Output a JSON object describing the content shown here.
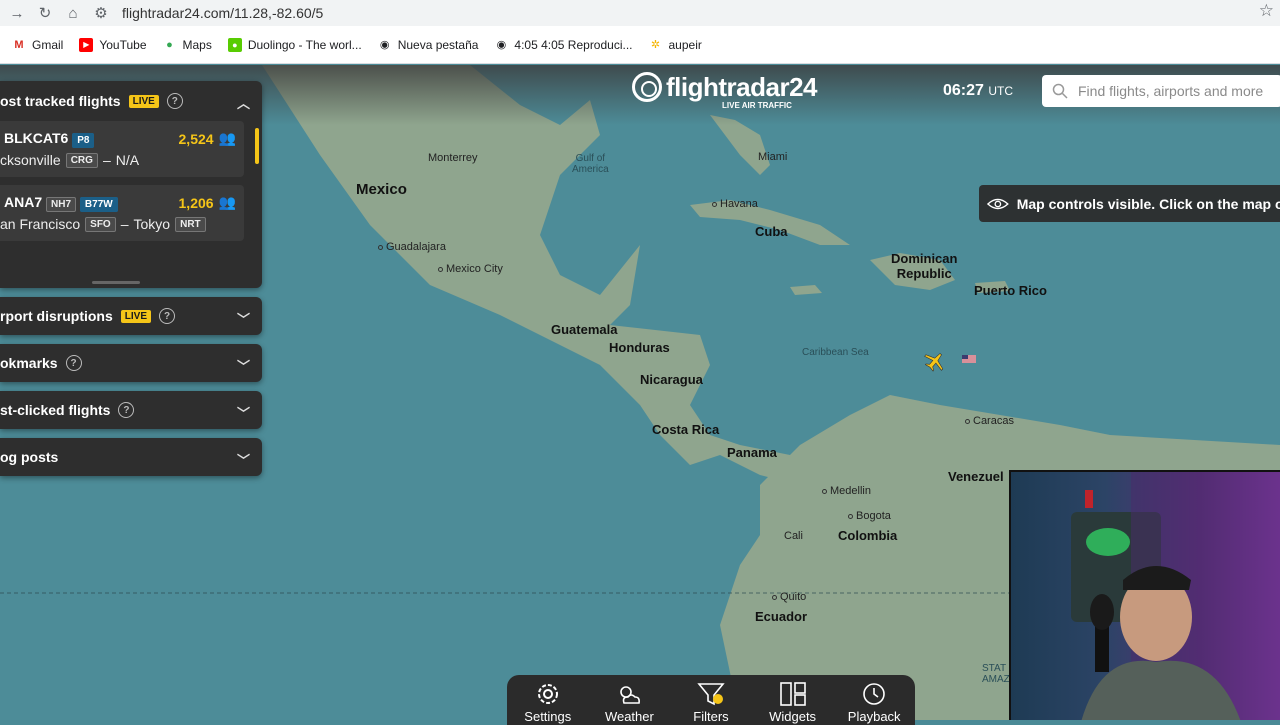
{
  "browser": {
    "url": "flightradar24.com/11.28,-82.60/5",
    "bookmarks": [
      {
        "label": "Gmail",
        "icon": "gmail-icon"
      },
      {
        "label": "YouTube",
        "icon": "youtube-icon"
      },
      {
        "label": "Maps",
        "icon": "maps-icon"
      },
      {
        "label": "Duolingo - The worl...",
        "icon": "duolingo-icon"
      },
      {
        "label": "Nueva pestaña",
        "icon": "globe-icon"
      },
      {
        "label": "4:05 4:05 Reproduci...",
        "icon": "globe-icon"
      },
      {
        "label": "aupeir",
        "icon": "app-icon"
      }
    ]
  },
  "header": {
    "logo": "flightradar24",
    "logo_sub": "LIVE AIR TRAFFIC",
    "time": "06:27",
    "time_zone": "UTC",
    "search_placeholder": "Find flights, airports and more"
  },
  "panel": {
    "most_tracked": {
      "title": "ost tracked flights",
      "live": "LIVE",
      "flights": [
        {
          "callsign": "BLKCAT6",
          "type": "P8",
          "count": "2,524",
          "route_from": "cksonville",
          "from_code": "CRG",
          "route_to": "N/A",
          "to_code": ""
        },
        {
          "callsign": "ANA7",
          "airline": "NH7",
          "type": "B77W",
          "count": "1,206",
          "route_from": "an Francisco",
          "from_code": "SFO",
          "route_to": "Tokyo",
          "to_code": "NRT"
        }
      ]
    },
    "sections": [
      {
        "title": "rport disruptions",
        "live": "LIVE"
      },
      {
        "title": "okmarks",
        "live": ""
      },
      {
        "title": "st-clicked flights",
        "live": ""
      },
      {
        "title": "og posts",
        "live": ""
      }
    ]
  },
  "banner": "Map controls visible. Click on the map or",
  "toolbar": [
    {
      "label": "Settings",
      "icon": "gear-icon"
    },
    {
      "label": "Weather",
      "icon": "weather-icon"
    },
    {
      "label": "Filters",
      "icon": "filter-icon"
    },
    {
      "label": "Widgets",
      "icon": "widgets-icon"
    },
    {
      "label": "Playback",
      "icon": "playback-icon"
    }
  ],
  "map": {
    "countries": [
      "Mexico",
      "Cuba",
      "Dominican Republic",
      "Puerto Rico",
      "Guatemala",
      "Honduras",
      "Nicaragua",
      "Costa Rica",
      "Panama",
      "Colombia",
      "Venezuel",
      "Ecuador"
    ],
    "cities": [
      "Monterrey",
      "Guadalajara",
      "Mexico City",
      "Miami",
      "Havana",
      "Caracas",
      "Medellin",
      "Bogota",
      "Cali",
      "Quito"
    ],
    "seas": [
      "Gulf of America",
      "Caribbean Sea"
    ],
    "dominican_line1": "Dominican",
    "dominican_line2": "Republic",
    "gulf_line1": "Gulf of",
    "gulf_line2": "America",
    "brazil_partial1": "STAT",
    "brazil_partial2": "AMAZ"
  }
}
